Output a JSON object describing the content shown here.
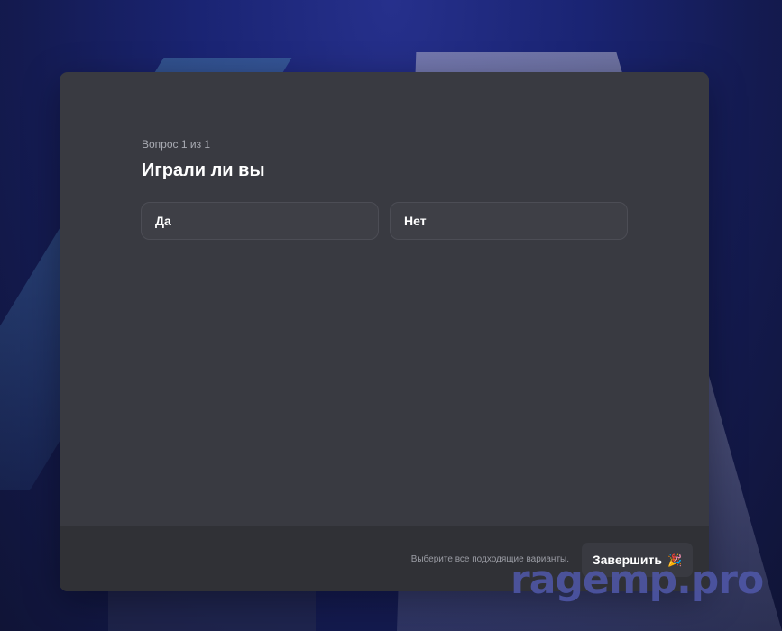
{
  "quiz": {
    "counter": "Вопрос 1 из 1",
    "question": "Играли ли вы",
    "options": [
      {
        "label": "Да"
      },
      {
        "label": "Нет"
      }
    ]
  },
  "footer": {
    "hint": "Выберите все подходящие варианты.",
    "finish_label": "Завершить",
    "finish_icon": "party-popper-icon",
    "finish_icon_glyph": "🎉"
  },
  "watermark": "ragemp.pro",
  "colors": {
    "modal": "#393a41",
    "footer": "#303136",
    "text": "#ffffff",
    "muted": "#a9abb3"
  }
}
